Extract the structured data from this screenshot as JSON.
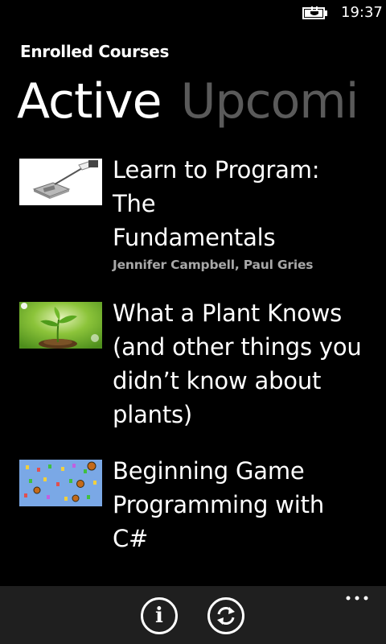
{
  "status_bar": {
    "time": "19:37",
    "battery_icon": "battery-charging-icon"
  },
  "header": {
    "app_title": "Enrolled Courses"
  },
  "pivot": {
    "tabs": [
      {
        "label": "Active",
        "selected": true
      },
      {
        "label": "Upcoming",
        "selected": false
      }
    ],
    "visible_inactive_text": "Upcomi"
  },
  "courses": [
    {
      "title": "Learn to Program: The Fundamentals",
      "title_lines": [
        "Learn to Program: The",
        "Fundamentals"
      ],
      "instructors": "Jennifer Campbell, Paul Gries",
      "thumbnail": "programming-device-thumbnail"
    },
    {
      "title": "What a Plant Knows (and other things you didn’t know about plants)",
      "title_lines": [
        "What a Plant Knows",
        "(and other things you",
        "didn’t know about",
        "plants)"
      ],
      "instructors": "",
      "thumbnail": "plant-sprout-thumbnail"
    },
    {
      "title": "Beginning Game Programming with C#",
      "title_lines": [
        "Beginning Game",
        "Programming with C#"
      ],
      "instructors": "",
      "thumbnail": "game-sprites-thumbnail"
    }
  ],
  "app_bar": {
    "buttons": [
      {
        "icon": "info-icon",
        "glyph": "i"
      },
      {
        "icon": "refresh-icon"
      }
    ],
    "more_icon": "more-options-icon"
  },
  "colors": {
    "background": "#000000",
    "text_primary": "#ffffff",
    "text_secondary": "#a8a8a8",
    "pivot_inactive": "#5a5a5a",
    "app_bar": "#1f1f1f"
  }
}
